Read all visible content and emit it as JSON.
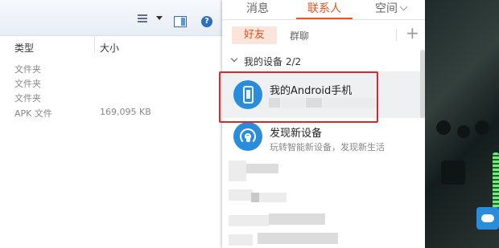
{
  "explorer": {
    "columns": [
      "类型",
      "大小"
    ],
    "rows": [
      {
        "type": "文件夹",
        "size": ""
      },
      {
        "type": "文件夹",
        "size": ""
      },
      {
        "type": "文件夹",
        "size": ""
      },
      {
        "type": "APK 文件",
        "size": "169,095 KB"
      }
    ],
    "toolbar": {
      "view_icon": "view-list-icon",
      "pane_icon": "preview-pane-icon",
      "help_label": "?"
    }
  },
  "qq": {
    "tabs": [
      {
        "label": "消息",
        "active": false
      },
      {
        "label": "联系人",
        "active": true
      },
      {
        "label": "空间",
        "active": false
      }
    ],
    "subtabs": {
      "friends": "好友",
      "groups": "群聊",
      "add": "+"
    },
    "group": {
      "title": "我的设备 2/2"
    },
    "devices": [
      {
        "name": "我的Android手机",
        "subtitle": "",
        "icon": "phone-icon",
        "selected": true
      },
      {
        "name": "发现新设备",
        "subtitle": "玩转智能新设备，发现新生活",
        "icon": "radar-icon",
        "selected": false
      }
    ],
    "accent_color": "#e8521e",
    "highlight_color": "#d9272b"
  }
}
